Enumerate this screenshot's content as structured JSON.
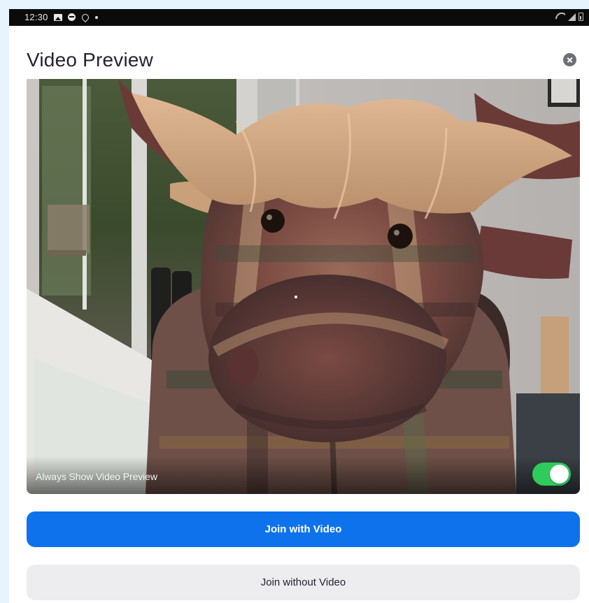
{
  "status_bar": {
    "time": "12:30",
    "left_icons": [
      "gallery-icon",
      "messenger-icon",
      "notification-icon",
      "dot-icon"
    ],
    "right_icons": [
      "wifi-icon",
      "signal-icon",
      "battery-icon"
    ]
  },
  "dialog": {
    "title": "Video Preview",
    "close_icon": "close-icon"
  },
  "preview": {
    "always_show_label": "Always Show Video Preview",
    "always_show_enabled": true
  },
  "buttons": {
    "join_with_video": "Join with Video",
    "join_without_video": "Join without Video"
  },
  "colors": {
    "page_background": "#e6f4fd",
    "primary_button": "#0e72ed",
    "secondary_button": "#ededf0",
    "toggle_on": "#2ecc5a",
    "title_text": "#232333"
  }
}
